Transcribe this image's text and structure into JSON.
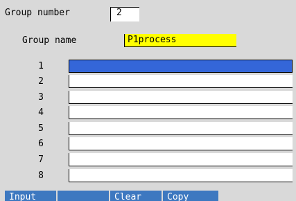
{
  "group_number": {
    "label": "Group number",
    "value": "2"
  },
  "group_name": {
    "label": "Group name",
    "value": "P1process"
  },
  "rows": [
    {
      "number": "1",
      "value": ""
    },
    {
      "number": "2",
      "value": ""
    },
    {
      "number": "3",
      "value": ""
    },
    {
      "number": "4",
      "value": ""
    },
    {
      "number": "5",
      "value": ""
    },
    {
      "number": "6",
      "value": ""
    },
    {
      "number": "7",
      "value": ""
    },
    {
      "number": "8",
      "value": ""
    }
  ],
  "selected_row": "1",
  "softkeys": [
    "Input",
    "",
    "Clear",
    "Copy"
  ],
  "colors": {
    "background": "#d9d9d9",
    "name_highlight": "#ffff00",
    "selection": "#3466d8",
    "softkey": "#3d78c0"
  }
}
